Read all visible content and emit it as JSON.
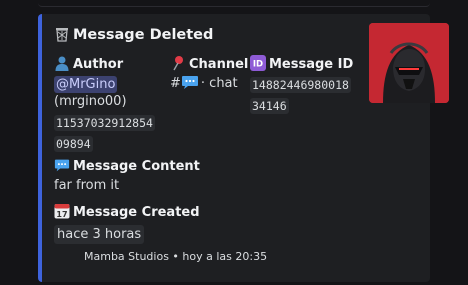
{
  "embed": {
    "title": "Message Deleted",
    "author": {
      "label": "Author",
      "mention": "@MrGino",
      "username": "(mrgino00)",
      "id_line1": "11537032912854",
      "id_line2": "09894"
    },
    "channel": {
      "label": "Channel",
      "prefix": "#",
      "name": "· chat"
    },
    "message_id": {
      "label": "Message ID",
      "line1": "14882446980018",
      "line2": "34146"
    },
    "content": {
      "label": "Message Content",
      "value": "far from it"
    },
    "created": {
      "label": "Message Created",
      "value": "hace 3 horas"
    },
    "footer": "Mamba Studios • hoy a las 20:35",
    "accent_color": "#3e63dd",
    "icons": [
      "wastebasket-icon",
      "bust-icon",
      "pushpin-icon",
      "id-icon",
      "speech-bubble-icon",
      "calendar-icon"
    ]
  }
}
